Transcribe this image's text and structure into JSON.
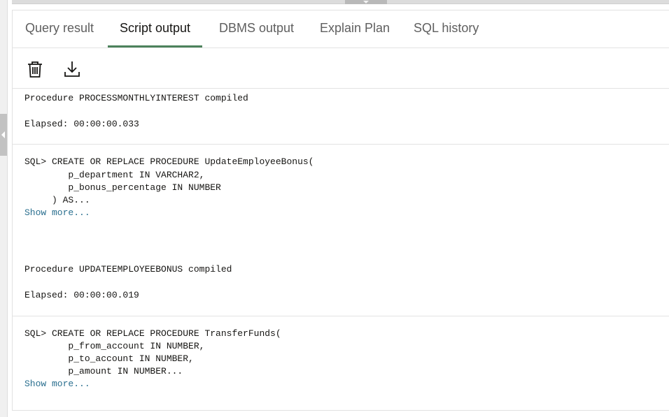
{
  "tabs": [
    {
      "label": "Query result",
      "active": false
    },
    {
      "label": "Script output",
      "active": true
    },
    {
      "label": "DBMS output",
      "active": false
    },
    {
      "label": "Explain Plan",
      "active": false
    },
    {
      "label": "SQL history",
      "active": false
    }
  ],
  "toolbar": {
    "clear_icon": "trash-icon",
    "download_icon": "download-icon"
  },
  "colors": {
    "active_tab_underline": "#4c825c",
    "show_more_link": "#2a6f8f"
  },
  "output": {
    "block1": {
      "line1": "Procedure PROCESSMONTHLYINTEREST compiled",
      "line2": "Elapsed: 00:00:00.033"
    },
    "block2": {
      "line1": "SQL> CREATE OR REPLACE PROCEDURE UpdateEmployeeBonus(",
      "line2": "        p_department IN VARCHAR2,",
      "line3": "        p_bonus_percentage IN NUMBER",
      "line4": "     ) AS...",
      "show_more": "Show more..."
    },
    "block3": {
      "line1": "Procedure UPDATEEMPLOYEEBONUS compiled",
      "line2": "Elapsed: 00:00:00.019"
    },
    "block4": {
      "line1": "SQL> CREATE OR REPLACE PROCEDURE TransferFunds(",
      "line2": "        p_from_account IN NUMBER,",
      "line3": "        p_to_account IN NUMBER,",
      "line4": "        p_amount IN NUMBER...",
      "show_more": "Show more..."
    }
  }
}
